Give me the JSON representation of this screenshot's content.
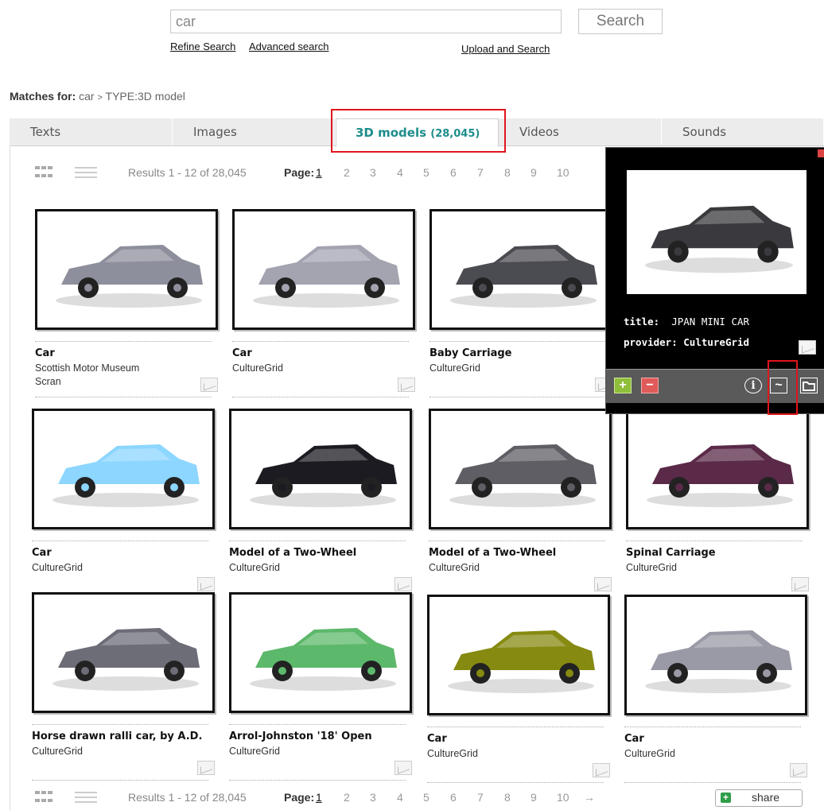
{
  "search": {
    "query": "car",
    "button_label": "Search",
    "refine_link": "Refine Search",
    "advanced_link": "Advanced search",
    "upload_link": "Upload and Search"
  },
  "matches": {
    "label": "Matches for:",
    "query": "car",
    "separator": ">",
    "filter": "TYPE:3D model"
  },
  "tabs": [
    {
      "label": "Texts"
    },
    {
      "label": "Images"
    },
    {
      "label": "3D models",
      "count": "(28,045)"
    },
    {
      "label": "Videos"
    },
    {
      "label": "Sounds"
    }
  ],
  "results": {
    "count_text": "Results 1 - 12 of 28,045",
    "page_label": "Page:",
    "pages": [
      "1",
      "2",
      "3",
      "4",
      "5",
      "6",
      "7",
      "8",
      "9",
      "10"
    ],
    "next_arrow": "→"
  },
  "cards": [
    {
      "title": "Car",
      "provider": "Scottish Motor Museum",
      "provider2": "Scran",
      "color": "#8e8f9c"
    },
    {
      "title": "Car",
      "provider": "CultureGrid",
      "color": "#a3a4b0"
    },
    {
      "title": "Baby Carriage",
      "provider": "CultureGrid",
      "color": "#4b4b52"
    },
    {
      "title": "Car",
      "provider": "CultureGrid",
      "color": "#8cd6ff"
    },
    {
      "title": "Model of a Two-Wheel",
      "provider": "CultureGrid",
      "color": "#1b1b21"
    },
    {
      "title": "Model of a Two-Wheel",
      "provider": "CultureGrid",
      "color": "#5e5e64"
    },
    {
      "title": "Spinal Carriage",
      "provider": "CultureGrid",
      "color": "#5a2a48"
    },
    {
      "title": "Horse drawn ralli car, by A.D.",
      "provider": "CultureGrid",
      "color": "#6d6d78"
    },
    {
      "title": "Arrol-Johnston '18' Open",
      "provider": "CultureGrid",
      "color": "#5cb86a"
    },
    {
      "title": "Car",
      "provider": "CultureGrid",
      "color": "#868a10"
    },
    {
      "title": "Car",
      "provider": "CultureGrid",
      "color": "#9a9aa6"
    }
  ],
  "popup": {
    "title_label": "title:",
    "title_value": "JPAN MINI CAR",
    "provider_label": "provider:",
    "provider_value": "CultureGrid",
    "image_color": "#3a3a3e"
  },
  "share": {
    "label": "share"
  }
}
